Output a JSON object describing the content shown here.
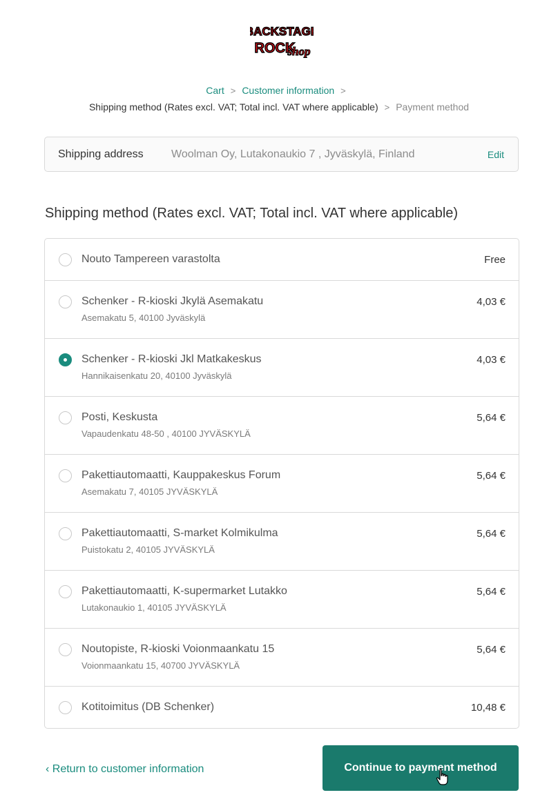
{
  "logo": {
    "line1": "BACKSTAGE",
    "line2": "ROCK",
    "line3": "shop"
  },
  "breadcrumb": {
    "cart": "Cart",
    "customer_information": "Customer information",
    "shipping_method": "Shipping method (Rates excl. VAT; Total incl. VAT where applicable)",
    "payment_method": "Payment method",
    "separator": ">"
  },
  "shipping_address": {
    "label": "Shipping address",
    "value": "Woolman Oy, Lutakonaukio 7 , Jyväskylä, Finland",
    "edit": "Edit"
  },
  "section_title": "Shipping method (Rates excl. VAT; Total incl. VAT where applicable)",
  "methods": [
    {
      "name": "Nouto Tampereen varastolta",
      "address": "",
      "price": "Free",
      "selected": false
    },
    {
      "name": "Schenker - R-kioski Jkylä Asemakatu",
      "address": "Asemakatu 5, 40100 Jyväskylä",
      "price": "4,03 €",
      "selected": false
    },
    {
      "name": "Schenker - R-kioski Jkl Matkakeskus",
      "address": "Hannikaisenkatu 20, 40100 Jyväskylä",
      "price": "4,03 €",
      "selected": true
    },
    {
      "name": "Posti, Keskusta",
      "address": "Vapaudenkatu 48-50 , 40100 JYVÄSKYLÄ",
      "price": "5,64 €",
      "selected": false
    },
    {
      "name": "Pakettiautomaatti, Kauppakeskus Forum",
      "address": "Asemakatu 7, 40105 JYVÄSKYLÄ",
      "price": "5,64 €",
      "selected": false
    },
    {
      "name": "Pakettiautomaatti, S-market Kolmikulma",
      "address": "Puistokatu 2, 40105 JYVÄSKYLÄ",
      "price": "5,64 €",
      "selected": false
    },
    {
      "name": "Pakettiautomaatti, K-supermarket Lutakko",
      "address": "Lutakonaukio 1, 40105 JYVÄSKYLÄ",
      "price": "5,64 €",
      "selected": false
    },
    {
      "name": "Noutopiste, R-kioski Voionmaankatu 15",
      "address": "Voionmaankatu 15, 40700 JYVÄSKYLÄ",
      "price": "5,64 €",
      "selected": false
    },
    {
      "name": "Kotitoimitus (DB Schenker)",
      "address": "",
      "price": "10,48 €",
      "selected": false
    }
  ],
  "footer": {
    "return_link": "Return to customer information",
    "continue_button": "Continue to payment method"
  },
  "colors": {
    "accent": "#1a8c7e",
    "button": "#1a7a6c",
    "border": "#d9d9d9",
    "logo_red": "#d8141c"
  }
}
